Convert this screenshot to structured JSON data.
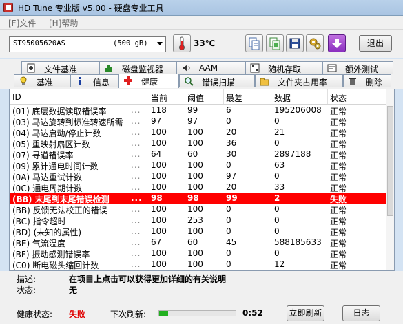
{
  "window": {
    "title": "HD Tune 专业版 v5.00 - 硬盘专业工具"
  },
  "menu": {
    "file": "[F]文件",
    "help": "[H]帮助"
  },
  "toolbar": {
    "drive_name": "ST95005620AS",
    "drive_size": "(500 gB)",
    "temperature": "33℃",
    "exit_label": "退出"
  },
  "tabs_row1": [
    "文件基准",
    "磁盘监视器",
    "AAM",
    "随机存取",
    "额外测试"
  ],
  "tabs_row2": [
    "基准",
    "信息",
    "健康",
    "错误扫描",
    "文件夹占用率",
    "删除"
  ],
  "active_tab": "健康",
  "table": {
    "headers": [
      "ID",
      "当前",
      "阈值",
      "最差",
      "数据",
      "状态"
    ],
    "rows": [
      {
        "id": "(01) 底层数据读取错误率",
        "cur": "118",
        "thr": "99",
        "worst": "6",
        "data": "195206008",
        "status": "正常"
      },
      {
        "id": "(03) 马达旋转到标准转速所需",
        "cur": "97",
        "thr": "97",
        "worst": "0",
        "data": "0",
        "status": "正常"
      },
      {
        "id": "(04) 马达启动/停止计数",
        "cur": "100",
        "thr": "100",
        "worst": "20",
        "data": "21",
        "status": "正常"
      },
      {
        "id": "(05) 重映射扇区计数",
        "cur": "100",
        "thr": "100",
        "worst": "36",
        "data": "0",
        "status": "正常"
      },
      {
        "id": "(07) 寻道错误率",
        "cur": "64",
        "thr": "60",
        "worst": "30",
        "data": "2897188",
        "status": "正常"
      },
      {
        "id": "(09) 累计通电时间计数",
        "cur": "100",
        "thr": "100",
        "worst": "0",
        "data": "63",
        "status": "正常"
      },
      {
        "id": "(0A) 马达重试计数",
        "cur": "100",
        "thr": "100",
        "worst": "97",
        "data": "0",
        "status": "正常"
      },
      {
        "id": "(0C) 通电周期计数",
        "cur": "100",
        "thr": "100",
        "worst": "20",
        "data": "33",
        "status": "正常"
      },
      {
        "id": "(B8) 末尾到末尾错误检测",
        "cur": "98",
        "thr": "98",
        "worst": "99",
        "data": "2",
        "status": "失败",
        "selected": true
      },
      {
        "id": "(BB) 反馈无法校正的错误",
        "cur": "100",
        "thr": "100",
        "worst": "0",
        "data": "0",
        "status": "正常"
      },
      {
        "id": "(BC) 指令超时",
        "cur": "100",
        "thr": "253",
        "worst": "0",
        "data": "0",
        "status": "正常"
      },
      {
        "id": "(BD) (未知的属性)",
        "cur": "100",
        "thr": "100",
        "worst": "0",
        "data": "0",
        "status": "正常"
      },
      {
        "id": "(BE) 气流温度",
        "cur": "67",
        "thr": "60",
        "worst": "45",
        "data": "588185633",
        "status": "正常"
      },
      {
        "id": "(BF) 振动感测错误率",
        "cur": "100",
        "thr": "100",
        "worst": "0",
        "data": "0",
        "status": "正常"
      },
      {
        "id": "(C0) 断电磁头缩回计数",
        "cur": "100",
        "thr": "100",
        "worst": "0",
        "data": "12",
        "status": "正常"
      }
    ]
  },
  "info": {
    "desc_label": "描述:",
    "desc_value": "在项目上点击可以获得更加详细的有关说明",
    "status_label": "状态:",
    "status_value": "无"
  },
  "bottom": {
    "health_label": "健康状态:",
    "health_value": "失败",
    "next_refresh_label": "下次刷新:",
    "refresh_progress": 0.12,
    "timer": "0:52",
    "refresh_button": "立即刷新",
    "log_button": "日志"
  },
  "colors": {
    "selected_row": "#ff0000",
    "fail_text": "#e00000",
    "progress": "#22b020"
  }
}
